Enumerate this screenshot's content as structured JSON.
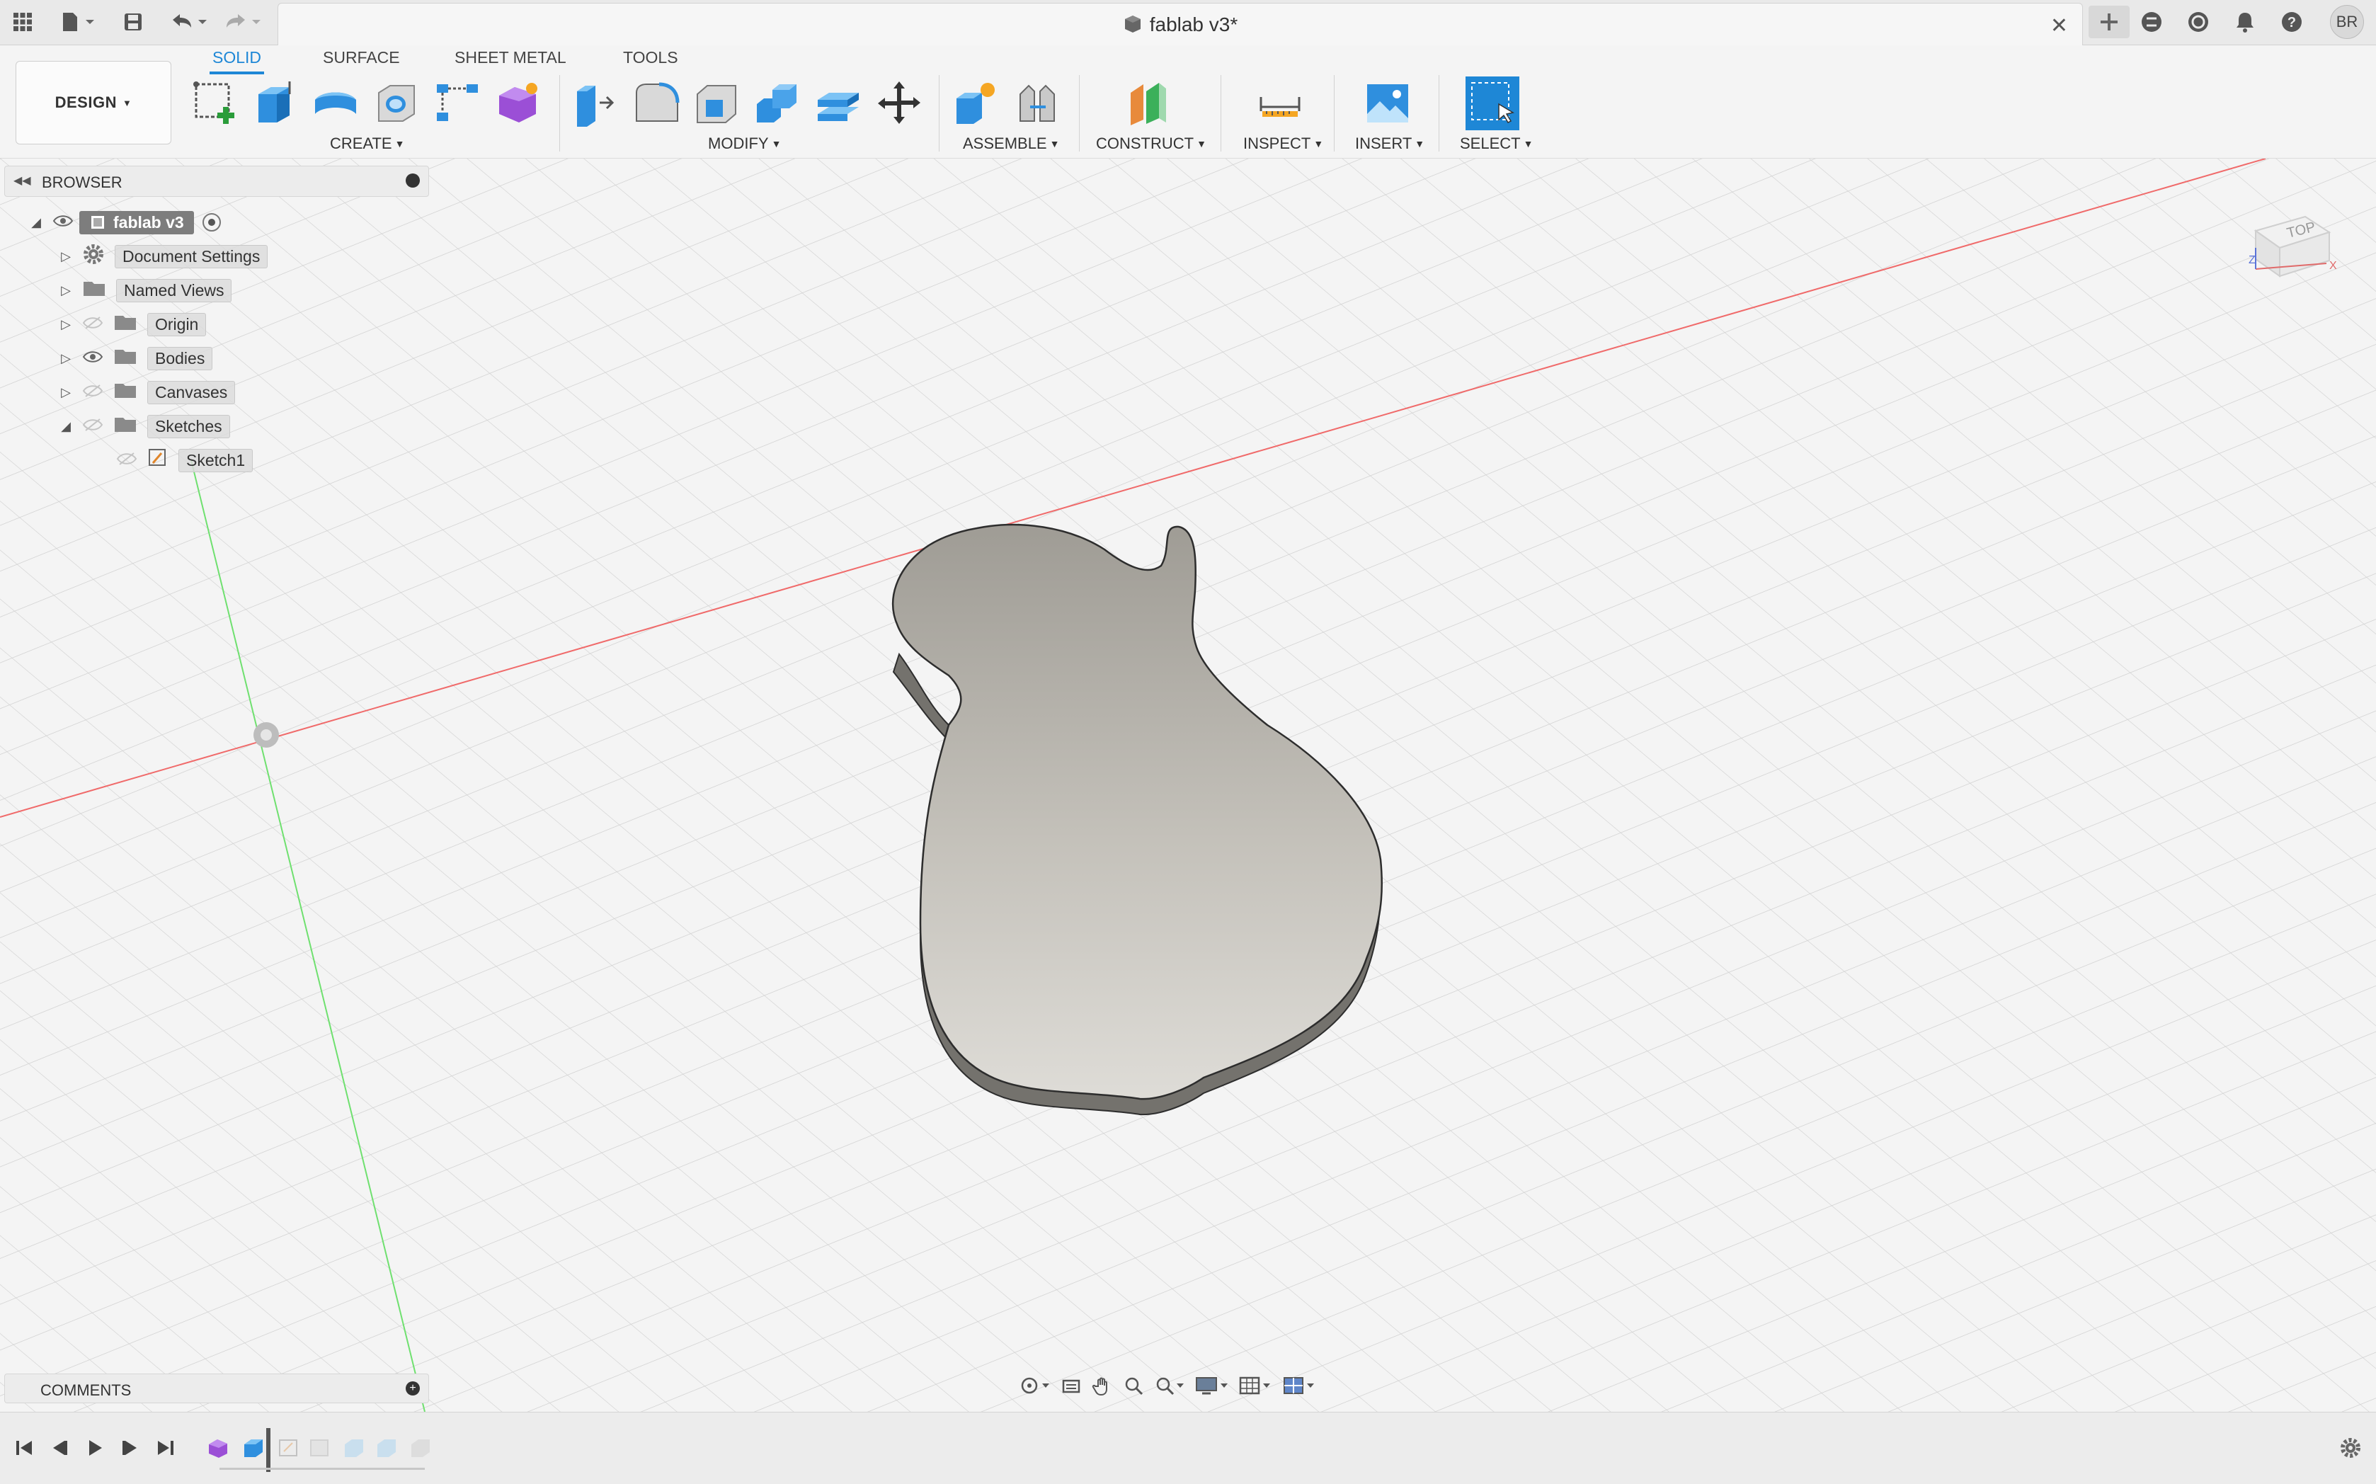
{
  "titlebar": {
    "document_title": "fablab v3*",
    "user_initials": "BR",
    "icons": [
      "apps-grid-icon",
      "file-icon",
      "save-icon",
      "undo-icon",
      "redo-icon",
      "new-tab-icon",
      "extensions-icon",
      "job-status-icon",
      "notifications-icon",
      "help-icon"
    ]
  },
  "toolbar": {
    "workspace": "DESIGN",
    "tabs": [
      {
        "label": "SOLID",
        "active": true
      },
      {
        "label": "SURFACE",
        "active": false
      },
      {
        "label": "SHEET METAL",
        "active": false
      },
      {
        "label": "TOOLS",
        "active": false
      }
    ],
    "groups": [
      {
        "label": "CREATE",
        "tools": [
          "create-sketch-icon",
          "extrude-icon",
          "revolve-icon",
          "hole-icon",
          "pattern-icon",
          "create-form-icon"
        ]
      },
      {
        "label": "MODIFY",
        "tools": [
          "press-pull-icon",
          "fillet-icon",
          "shell-icon",
          "combine-icon",
          "offset-face-icon",
          "move-icon"
        ]
      },
      {
        "label": "ASSEMBLE",
        "tools": [
          "new-component-icon",
          "joint-icon"
        ]
      },
      {
        "label": "CONSTRUCT",
        "tools": [
          "offset-plane-icon"
        ]
      },
      {
        "label": "INSPECT",
        "tools": [
          "measure-icon"
        ]
      },
      {
        "label": "INSERT",
        "tools": [
          "insert-image-icon"
        ]
      },
      {
        "label": "SELECT",
        "tools": [
          "select-icon"
        ]
      }
    ],
    "accent_color": "#1e87d6"
  },
  "browser": {
    "title": "BROWSER",
    "root": "fablab v3",
    "items": [
      {
        "label": "Document Settings",
        "icon": "gear-icon"
      },
      {
        "label": "Named Views",
        "icon": "folder-icon"
      },
      {
        "label": "Origin",
        "icon": "folder-icon"
      },
      {
        "label": "Bodies",
        "icon": "folder-icon"
      },
      {
        "label": "Canvases",
        "icon": "folder-icon"
      },
      {
        "label": "Sketches",
        "icon": "folder-icon"
      },
      {
        "label": "Sketch1",
        "icon": "sketch-icon"
      }
    ]
  },
  "viewcube": {
    "face": "TOP"
  },
  "comments": {
    "title": "COMMENTS"
  },
  "timeline": {
    "controls": [
      "first-icon",
      "previous-icon",
      "play-icon",
      "next-icon",
      "last-icon"
    ],
    "features": [
      "form-feature-icon",
      "sketch-feature-icon",
      "extrude-feature-icon"
    ]
  }
}
